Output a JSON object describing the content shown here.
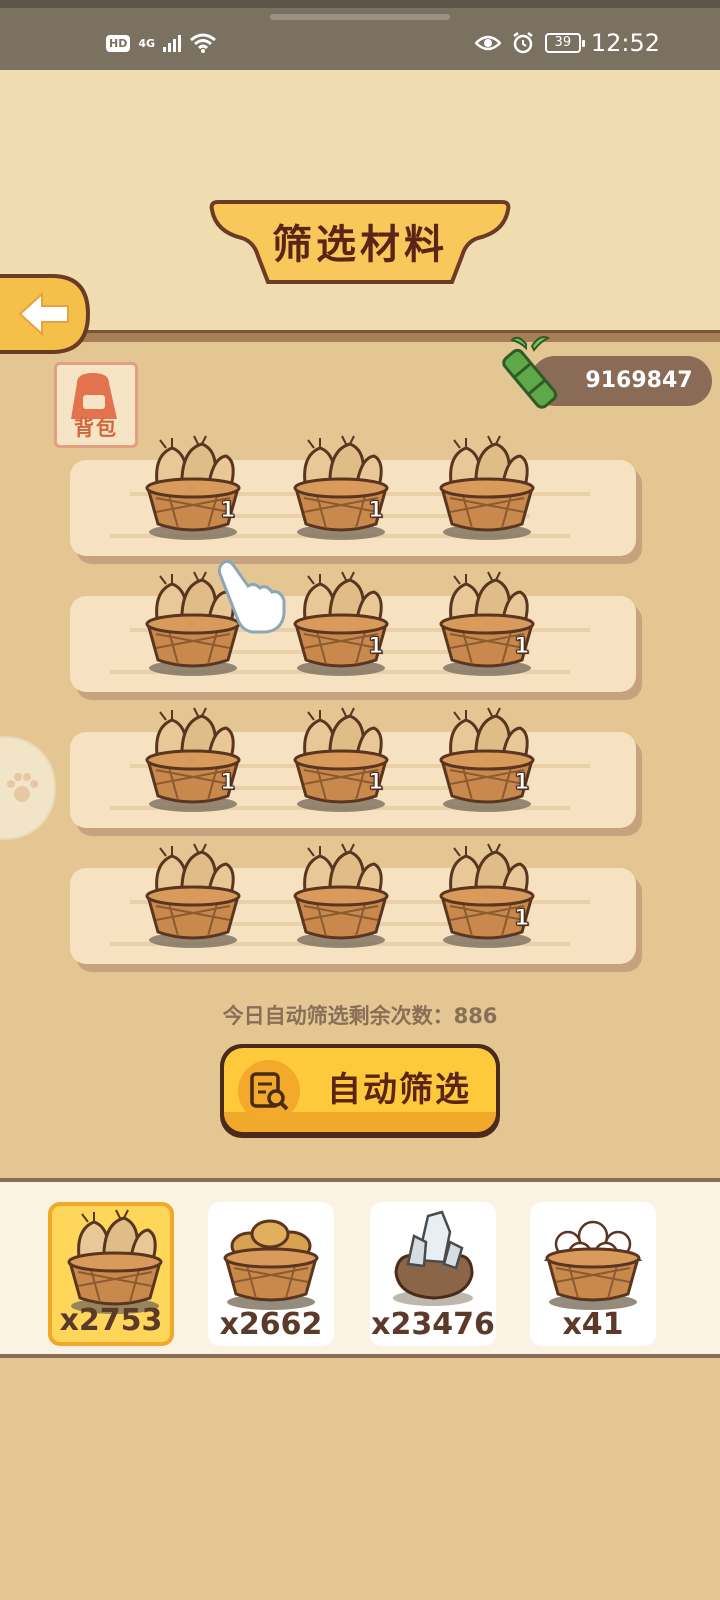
{
  "status_bar": {
    "hd": "HD",
    "network": "4G",
    "battery": "39",
    "time": "12:52"
  },
  "title": "筛选材料",
  "bag_label": "背包",
  "currency": {
    "icon": "bamboo-icon",
    "value": "9169847"
  },
  "grid": [
    [
      {
        "count": "1"
      },
      {
        "count": "1"
      },
      {
        "count": ""
      }
    ],
    [
      {
        "count": ""
      },
      {
        "count": "1"
      },
      {
        "count": "1"
      }
    ],
    [
      {
        "count": "1"
      },
      {
        "count": "1"
      },
      {
        "count": "1"
      }
    ],
    [
      {
        "count": ""
      },
      {
        "count": ""
      },
      {
        "count": "1"
      }
    ]
  ],
  "remaining_text": "今日自动筛选剩余次数：886",
  "auto_button_label": "自动筛选",
  "inventory": [
    {
      "icon": "wheat-bundle-basket-icon",
      "count": "x2753",
      "active": true
    },
    {
      "icon": "potato-basket-icon",
      "count": "x2662",
      "active": false
    },
    {
      "icon": "crystal-ore-icon",
      "count": "x23476",
      "active": false
    },
    {
      "icon": "cotton-basket-icon",
      "count": "x41",
      "active": false
    }
  ],
  "colors": {
    "background": "#e3c692",
    "panel": "#efdcb0",
    "accent_yellow": "#ffc93c",
    "dark_brown": "#5b2516"
  }
}
